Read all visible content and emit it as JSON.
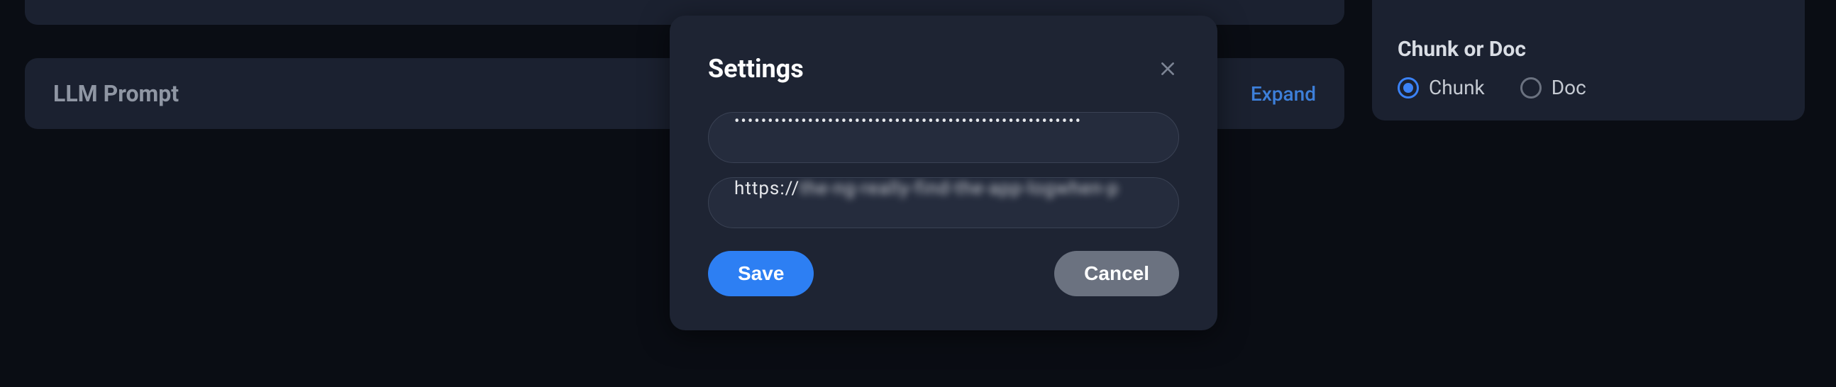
{
  "background": {
    "prompt_card": {
      "title": "LLM Prompt",
      "expand_label": "Expand"
    },
    "right_card": {
      "heading": "Chunk or Doc",
      "options": [
        {
          "label": "Chunk",
          "selected": true
        },
        {
          "label": "Doc",
          "selected": false
        }
      ]
    }
  },
  "modal": {
    "title": "Settings",
    "field1_value": "••••••••••••••••••••••••••••••••••••••••••••••••••••",
    "field2_prefix": "https://",
    "field2_blurred": "the-ng-really-find-the-app-logwhen-p",
    "save_label": "Save",
    "cancel_label": "Cancel"
  }
}
